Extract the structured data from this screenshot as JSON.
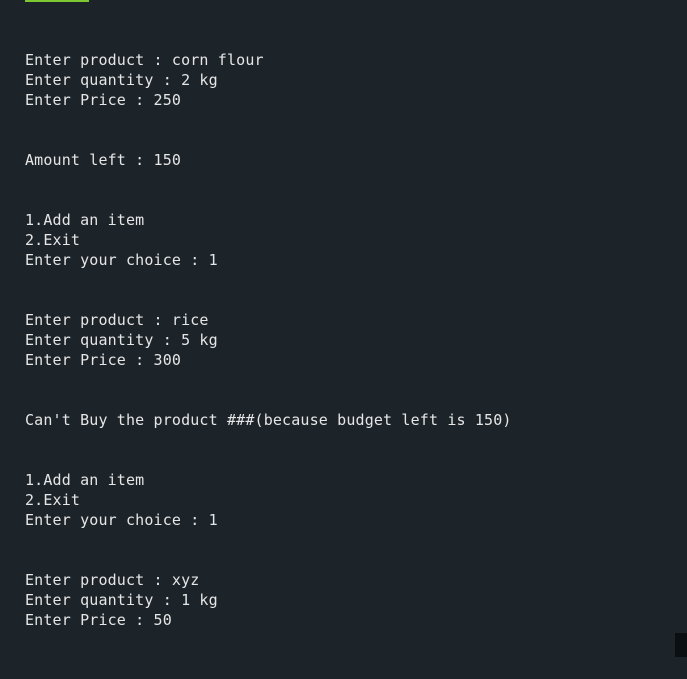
{
  "colors": {
    "background": "#1c2329",
    "text": "#e6e6e6",
    "accent": "#7ec832"
  },
  "output": {
    "line1": "Enter product : corn flour",
    "line2": "Enter quantity : 2 kg",
    "line3": "Enter Price : 250",
    "line4": "Amount left : 150",
    "line5": "1.Add an item",
    "line6": "2.Exit",
    "line7": "Enter your choice : 1",
    "line8": "Enter product : rice",
    "line9": "Enter quantity : 5 kg",
    "line10": "Enter Price : 300",
    "line11": "Can't Buy the product ###(because budget left is 150)",
    "line12": "1.Add an item",
    "line13": "2.Exit",
    "line14": "Enter your choice : 1",
    "line15": "Enter product : xyz",
    "line16": "Enter quantity : 1 kg",
    "line17": "Enter Price : 50"
  }
}
